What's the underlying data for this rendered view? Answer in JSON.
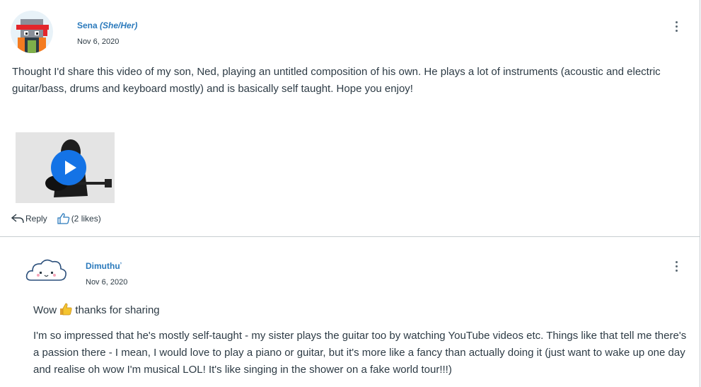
{
  "posts": [
    {
      "author": "Sena",
      "pronouns": "(She/Her)",
      "date": "Nov 6, 2020",
      "paragraphs": [
        "Thought I'd share this video of my son, Ned, playing an untitled composition of his own. He plays a lot of instruments (acoustic and electric guitar/bass, drums and keyboard mostly) and is basically self taught. Hope you enjoy!"
      ],
      "reply_label": "Reply",
      "likes_label": "(2 likes)"
    },
    {
      "author": "Dimuthu",
      "author_suffix": "ʼ",
      "date": "Nov 6, 2020",
      "greeting_before": "Wow",
      "greeting_after": "thanks for sharing",
      "paragraphs": [
        "I'm so impressed that he's mostly self-taught - my sister plays the guitar too by watching YouTube videos etc. Things like that tell me there's a passion there - I mean, I would love to play a piano or guitar, but it's more like a fancy than actually doing it (just want to wake up one day and realise oh wow I'm musical LOL! It's like singing in the shower on a fake world tour!!!)"
      ]
    }
  ],
  "colors": {
    "link": "#2b7abc",
    "text": "#2d3b45",
    "play": "#1473e6",
    "border": "#c7cdd1"
  },
  "icons": [
    "cat-avatar-icon",
    "cloud-avatar-icon",
    "kebab-menu-icon",
    "reply-arrow-icon",
    "thumbs-up-icon",
    "play-icon",
    "thumbs-up-emoji-icon"
  ]
}
